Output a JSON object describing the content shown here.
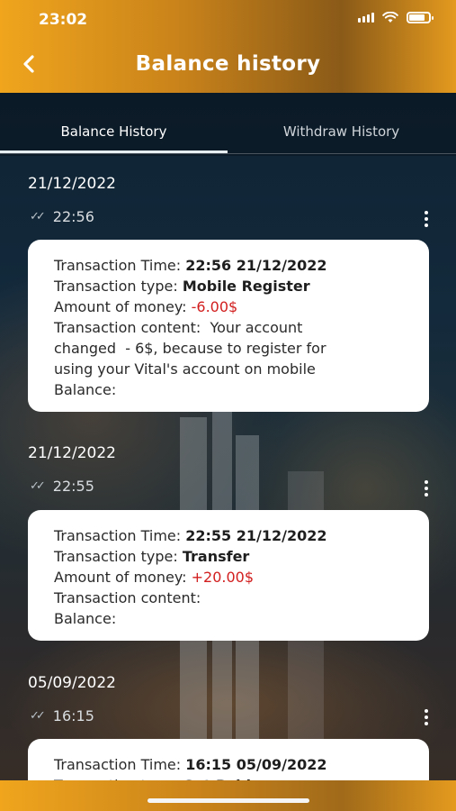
{
  "status_bar": {
    "time": "23:02"
  },
  "header": {
    "title": "Balance history"
  },
  "tabs": [
    {
      "label": "Balance History",
      "active": true
    },
    {
      "label": "Withdraw History",
      "active": false
    }
  ],
  "entries": [
    {
      "date": "21/12/2022",
      "time": "22:56",
      "labels": {
        "tx_time": "Transaction Time: ",
        "tx_type": "Transaction type: ",
        "amount": "Amount of money: ",
        "content": "Transaction content: ",
        "balance": "Balance:"
      },
      "tx_time": "22:56 21/12/2022",
      "tx_type": "Mobile Register",
      "amount": "-6.00$",
      "content_line1": " Your account",
      "content_line2": "changed  - 6$, because to register for",
      "content_line3": "using your Vital's account on mobile"
    },
    {
      "date": "21/12/2022",
      "time": "22:55",
      "labels": {
        "tx_time": "Transaction Time: ",
        "tx_type": "Transaction type: ",
        "amount": "Amount of money: ",
        "content": "Transaction content:",
        "balance": "Balance:"
      },
      "tx_time": "22:55 21/12/2022",
      "tx_type": "Transfer",
      "amount": "+20.00$"
    },
    {
      "date": "05/09/2022",
      "time": "16:15",
      "labels": {
        "tx_time": "Transaction Time: ",
        "tx_type": "Transaction type: "
      },
      "tx_time": "16:15 05/09/2022",
      "tx_type": "Get Paid"
    }
  ],
  "colors": {
    "accent": "#f0a51d",
    "negative": "#d21e1e"
  }
}
